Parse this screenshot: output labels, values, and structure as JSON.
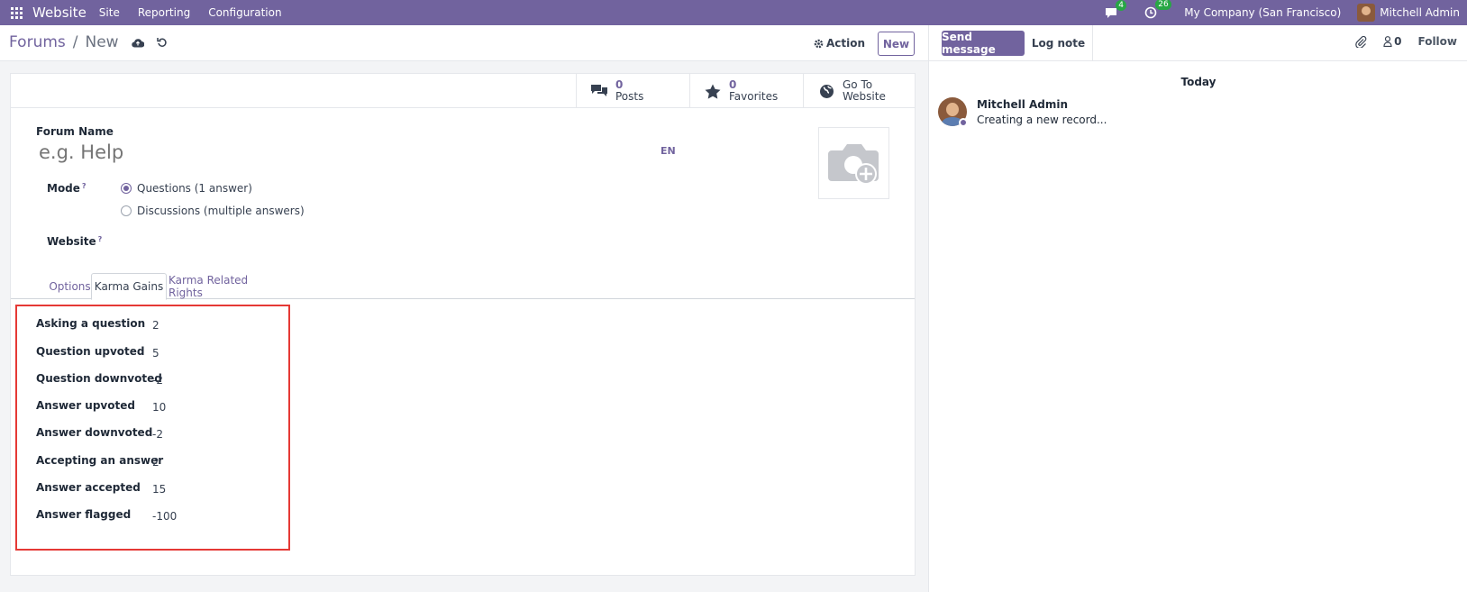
{
  "navbar": {
    "app_name": "Website",
    "menus": [
      "Site",
      "Reporting",
      "Configuration"
    ],
    "messages_count": "4",
    "activities_count": "26",
    "company": "My Company (San Francisco)",
    "user": "Mitchell Admin"
  },
  "control_panel": {
    "breadcrumb_parent": "Forums",
    "breadcrumb_current": "New",
    "action_label": "Action",
    "new_label": "New"
  },
  "stat_buttons": [
    {
      "value": "0",
      "label": "Posts",
      "icon": "comments-icon"
    },
    {
      "value": "0",
      "label": "Favorites",
      "icon": "star-icon"
    },
    {
      "value": "Go To",
      "label": "Website",
      "icon": "globe-icon"
    }
  ],
  "form": {
    "forum_name_label": "Forum Name",
    "forum_name_placeholder": "e.g. Help",
    "lang": "EN",
    "mode_label": "Mode",
    "help_mark": "?",
    "mode_options": [
      {
        "label": "Questions (1 answer)",
        "selected": true
      },
      {
        "label": "Discussions (multiple answers)",
        "selected": false
      }
    ],
    "website_label": "Website"
  },
  "tabs": [
    {
      "label": "Options",
      "active": false
    },
    {
      "label": "Karma Gains",
      "active": true
    },
    {
      "label": "Karma Related Rights",
      "active": false
    }
  ],
  "karma_gains": [
    {
      "label": "Asking a question",
      "value": "2"
    },
    {
      "label": "Question upvoted",
      "value": "5"
    },
    {
      "label": "Question downvoted",
      "value": "-2"
    },
    {
      "label": "Answer upvoted",
      "value": "10"
    },
    {
      "label": "Answer downvoted",
      "value": "-2"
    },
    {
      "label": "Accepting an answer",
      "value": "2"
    },
    {
      "label": "Answer accepted",
      "value": "15"
    },
    {
      "label": "Answer flagged",
      "value": "-100"
    }
  ],
  "chatter": {
    "send_message": "Send message",
    "log_note": "Log note",
    "followers_count": "0",
    "follow": "Follow",
    "date_separator": "Today",
    "message_author": "Mitchell Admin",
    "message_body": "Creating a new record..."
  },
  "colors": {
    "brand": "#71639e",
    "highlight_border": "#e53935",
    "badge": "#28a745"
  }
}
